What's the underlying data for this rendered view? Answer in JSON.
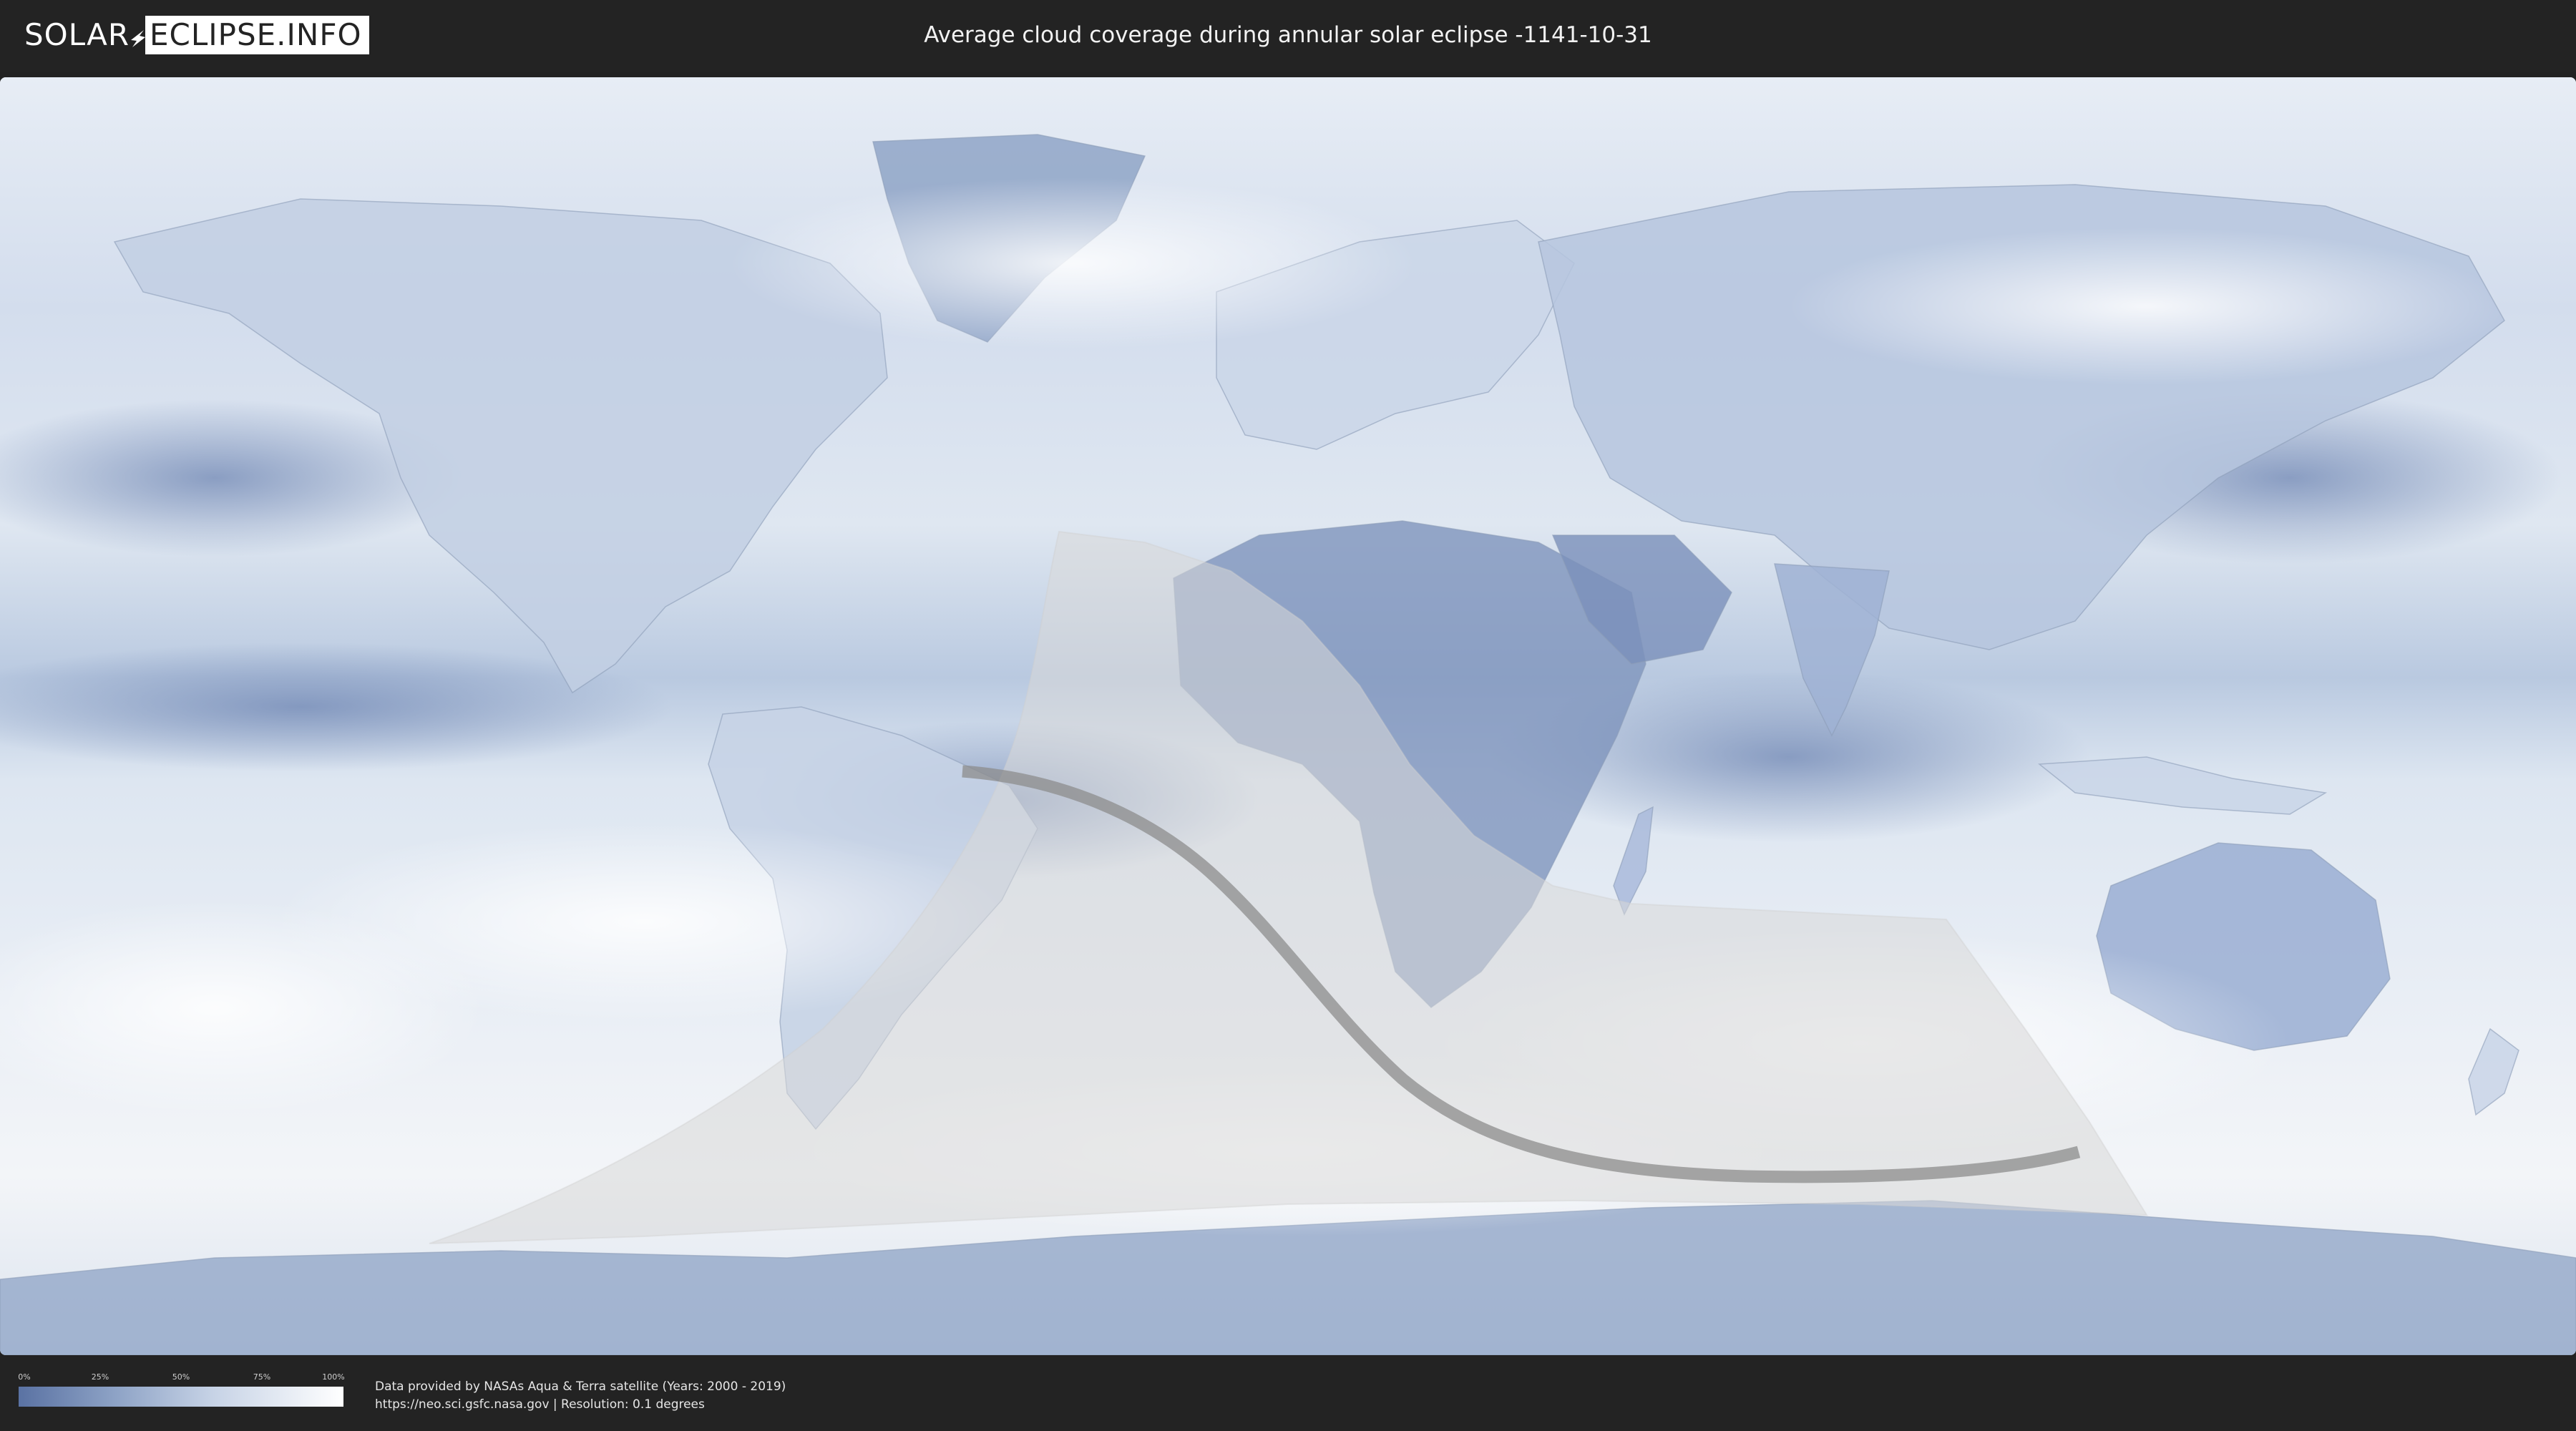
{
  "header": {
    "logo_left": "SOLAR",
    "logo_right": "ECLIPSE.INFO",
    "title": "Average cloud coverage during annular solar eclipse -1141-10-31"
  },
  "map": {
    "projection": "equirectangular",
    "colors": {
      "clear_sky": "#5a72a3",
      "full_cloud": "#ffffff",
      "eclipse_zone": "#d8d8d8",
      "central_path": "#8c8c8c"
    }
  },
  "legend": {
    "ticks": [
      "0%",
      "25%",
      "50%",
      "75%",
      "100%"
    ]
  },
  "credits": {
    "line1": "Data provided by NASAs Aqua & Terra satellite (Years: 2000 - 2019)",
    "line2": "https://neo.sci.gsfc.nasa.gov | Resolution: 0.1 degrees"
  }
}
